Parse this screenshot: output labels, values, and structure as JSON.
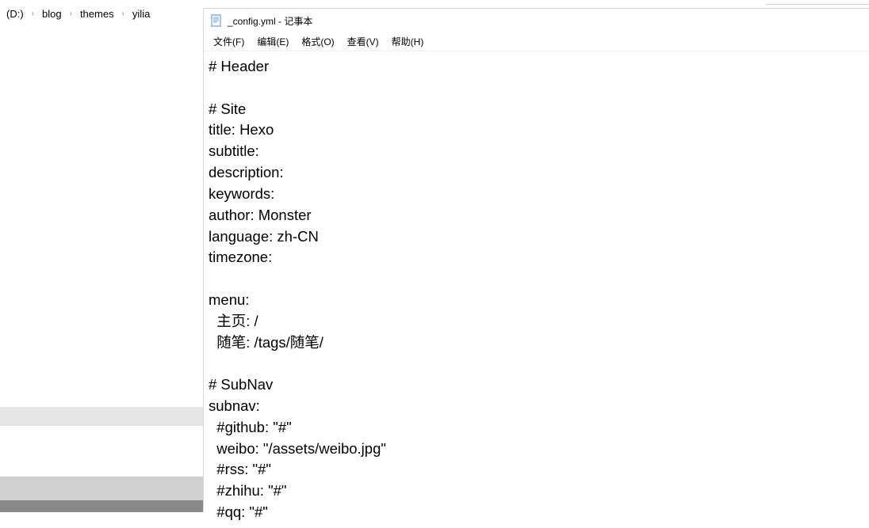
{
  "explorer": {
    "breadcrumb": {
      "drive": "(D:)",
      "items": [
        "blog",
        "themes",
        "yilia"
      ]
    }
  },
  "notepad": {
    "title": "_config.yml - 记事本",
    "menu": {
      "file": "文件(F)",
      "edit": "编辑(E)",
      "format": "格式(O)",
      "view": "查看(V)",
      "help": "帮助(H)"
    },
    "content": "# Header\n\n# Site\ntitle: Hexo\nsubtitle:\ndescription:\nkeywords:\nauthor: Monster\nlanguage: zh-CN\ntimezone:\n\nmenu:\n  主页: /\n  随笔: /tags/随笔/\n\n# SubNav\nsubnav:\n  #github: \"#\"\n  weibo: \"/assets/weibo.jpg\"\n  #rss: \"#\"\n  #zhihu: \"#\"\n  #qq: \"#\""
  }
}
